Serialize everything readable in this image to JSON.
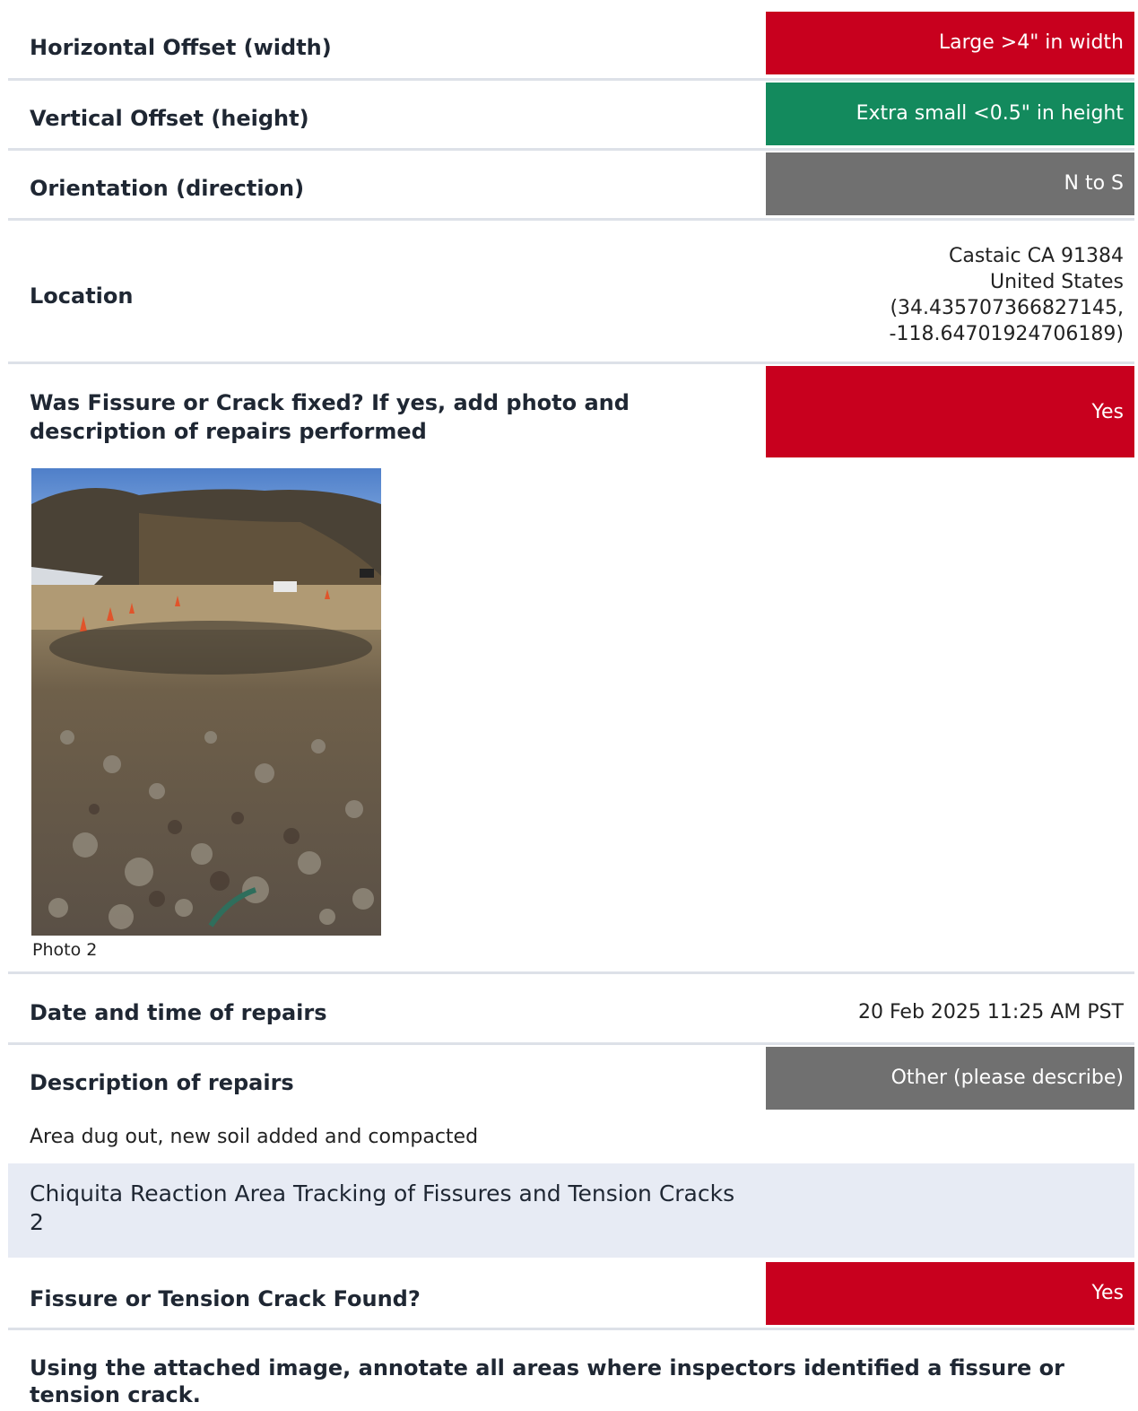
{
  "fields": {
    "horizontal_offset": {
      "label": "Horizontal Offset (width)",
      "value": "Large >4\" in width",
      "color": "#c8001e"
    },
    "vertical_offset": {
      "label": "Vertical Offset (height)",
      "value": "Extra small <0.5\" in height",
      "color": "#138a5d"
    },
    "orientation": {
      "label": "Orientation (direction)",
      "value": "N to S",
      "color": "#707070"
    },
    "location": {
      "label": "Location",
      "line1": "Castaic CA 91384",
      "line2": "United States",
      "line3": "(34.435707366827145,",
      "line4": "-118.64701924706189)"
    },
    "fixed": {
      "label": "Was Fissure or Crack fixed? If yes, add photo and description of repairs performed",
      "value": "Yes",
      "color": "#c8001e"
    },
    "photo_caption": "Photo 2",
    "repair_datetime": {
      "label": "Date and time of repairs",
      "value": "20 Feb 2025 11:25 AM PST"
    },
    "repair_description": {
      "label": "Description of repairs",
      "value": "Other (please describe)",
      "color": "#707070",
      "text": "Area dug out, new soil added and compacted"
    }
  },
  "section": {
    "title": "Chiquita Reaction Area Tracking of Fissures and Tension Cracks 2"
  },
  "section_fields": {
    "found": {
      "label": "Fissure or Tension Crack Found?",
      "value": "Yes",
      "color": "#c8001e"
    },
    "annotate_prompt": "Using the attached image, annotate all areas where inspectors identified a fissure or tension crack."
  }
}
